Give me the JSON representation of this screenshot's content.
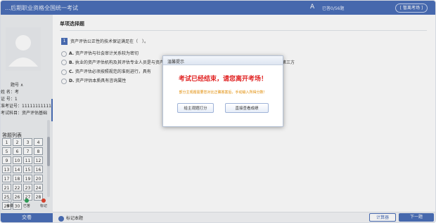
{
  "header": {
    "title": "…后期职业资格全国统一考试",
    "font_icon": "A",
    "progress": "已答0/56题",
    "exit_label": "[ 暂离考场 ]"
  },
  "sidebar": {
    "info": [
      "题号 ∧",
      "姓 名：考",
      "证 号：1",
      "准考证号：11111111111",
      "考试科目：资产评估基础"
    ],
    "qnav_title": "答题列表",
    "numbers": [
      "1",
      "2",
      "3",
      "4",
      "5",
      "6",
      "7",
      "8",
      "9",
      "10",
      "11",
      "12",
      "13",
      "14",
      "15",
      "16",
      "17",
      "18",
      "19",
      "20",
      "21",
      "22",
      "23",
      "24",
      "25",
      "26",
      "27",
      "28",
      "29",
      "30"
    ],
    "legend": [
      "未做",
      "已答",
      "标记"
    ],
    "submit_label": "交卷"
  },
  "main": {
    "section_title": "单项选择题",
    "question_number": "1",
    "question_text": "资产评估公正性的技术保证满足在（　）。",
    "options": [
      {
        "letter": "A.",
        "text": "资产评估与社会审计关系较为密切"
      },
      {
        "letter": "B.",
        "text": "执业的资产评估机构及其评估专业人员是与资产业务和当事人双方无利害关系的"
      },
      {
        "letter": "C.",
        "text": "资产评估必须按照规范的准则进行，具有"
      },
      {
        "letter": "D.",
        "text": "资产评估本质具有咨询属性"
      }
    ],
    "option_b_tail": "第三方"
  },
  "bottom": {
    "mark_label": "标记本题",
    "calc_label": "计算器",
    "next_label": "下一题"
  },
  "dialog": {
    "title": "温馨提示",
    "main_text": "考试已经结束，请您离开考场！",
    "note_text": "部分主观题需要您对比正确答案后，手动输入所得分数！",
    "button1": "给主观题打分",
    "button2": "直接查看成绩"
  },
  "colors": {
    "accent": "#4b6fb8",
    "alert": "#e02020",
    "note": "#e08a00"
  }
}
